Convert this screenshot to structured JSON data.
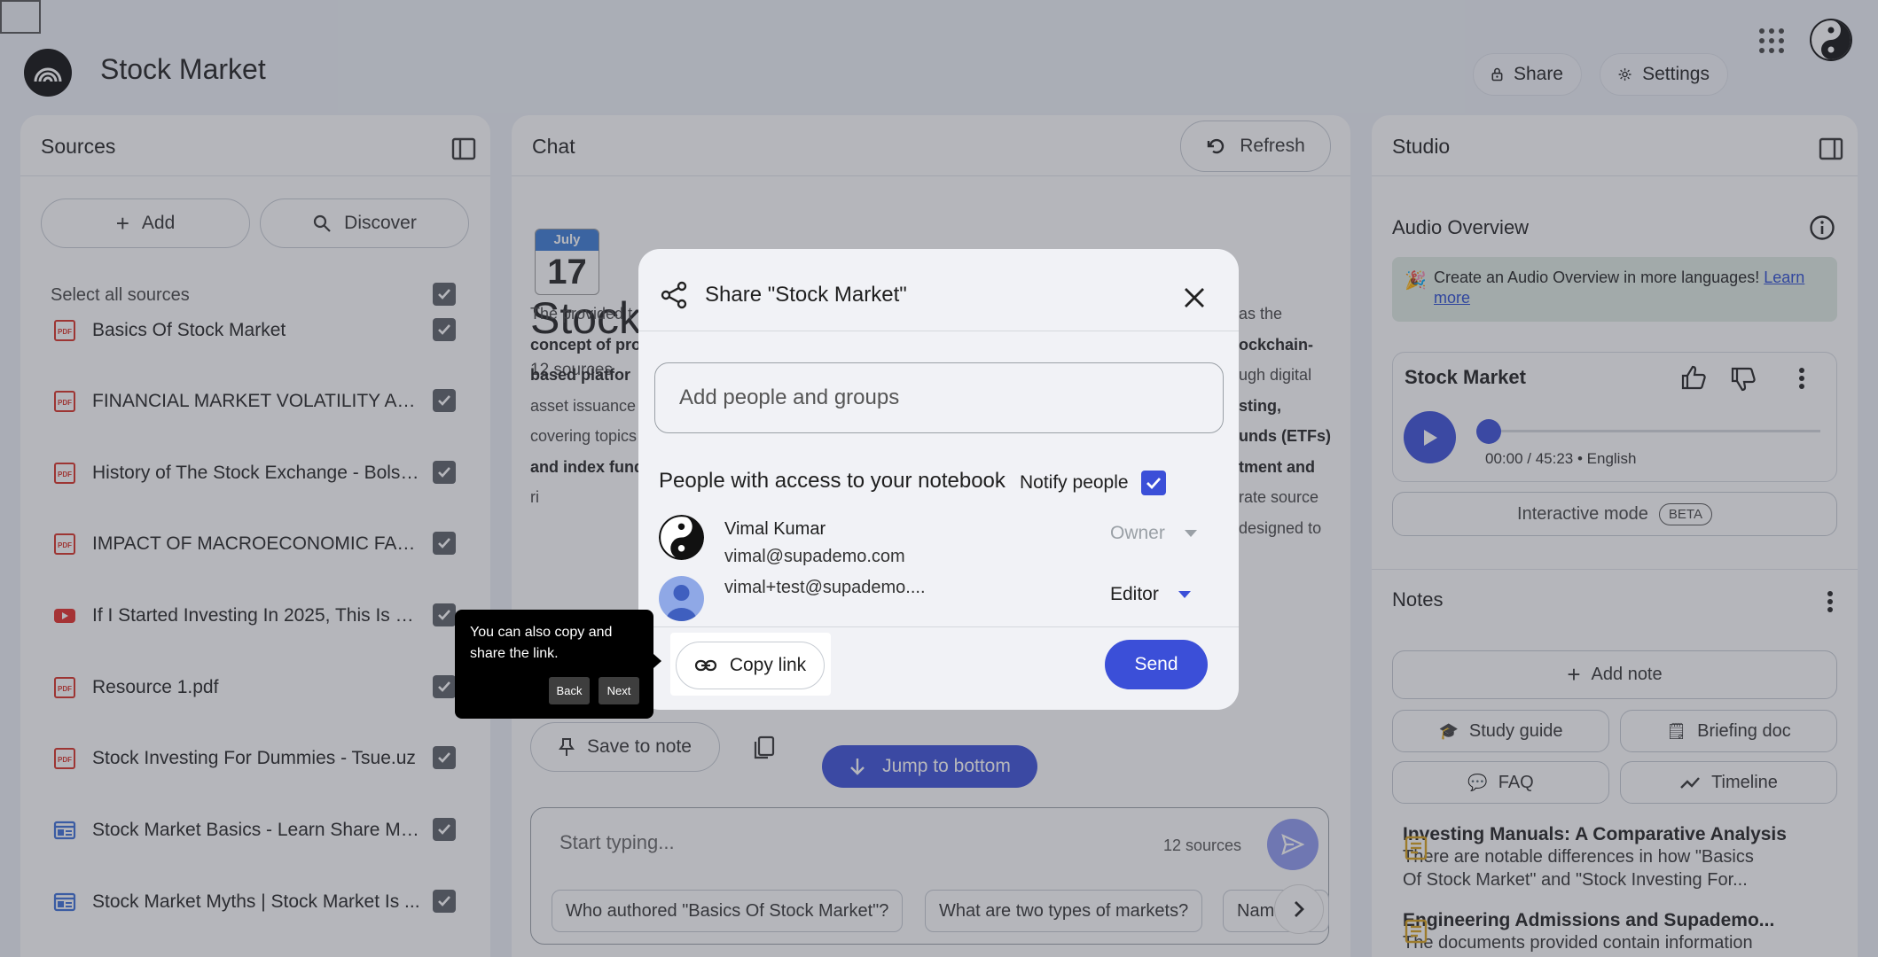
{
  "app": {
    "title": "Stock Market",
    "share_label": "Share",
    "settings_label": "Settings"
  },
  "sources": {
    "title": "Sources",
    "add_label": "Add",
    "discover_label": "Discover",
    "select_all_label": "Select all sources",
    "items": [
      {
        "label": "Basics Of Stock Market",
        "icon": "pdf-icon"
      },
      {
        "label": "FINANCIAL MARKET VOLATILITY AND I...",
        "icon": "pdf-icon"
      },
      {
        "label": "History of The Stock Exchange - Bolsa...",
        "icon": "pdf-icon"
      },
      {
        "label": "IMPACT OF MACROECONOMIC FACTO...",
        "icon": "pdf-icon"
      },
      {
        "label": "If I Started Investing In 2025, This Is W...",
        "icon": "youtube-icon"
      },
      {
        "label": "Resource 1.pdf",
        "icon": "pdf-icon"
      },
      {
        "label": "Stock Investing For Dummies - Tsue.uz",
        "icon": "pdf-icon"
      },
      {
        "label": "Stock Market Basics - Learn Share Ma...",
        "icon": "web-icon"
      },
      {
        "label": "Stock Market Myths | Stock Market Is ...",
        "icon": "web-icon"
      }
    ]
  },
  "chat": {
    "title": "Chat",
    "refresh_label": "Refresh",
    "calendar_month": "July",
    "calendar_day": "17",
    "notebook_title_partial": "Stock",
    "sources_count": "12 sources",
    "summary_lines": [
      {
        "left": "The provided t",
        "right": "as the"
      },
      {
        "left": "concept of pro",
        "right": "ockchain-"
      },
      {
        "left": "based platfor",
        "right": "ugh digital"
      },
      {
        "left": "asset issuance",
        "right": "sting,"
      },
      {
        "left": "covering topics",
        "right": "unds (ETFs)"
      },
      {
        "left": "and index fund",
        "right": "tment and"
      },
      {
        "left": "ri",
        "right": "rate source"
      },
      {
        "left": "",
        "right": "designed to"
      }
    ],
    "save_to_note_label": "Save to note",
    "jump_to_bottom_label": "Jump to bottom",
    "input_placeholder": "Start typing...",
    "input_sources_count": "12 sources",
    "suggestions": [
      "Who authored \"Basics Of Stock Market\"?",
      "What are two types of markets?",
      "Nam"
    ]
  },
  "studio": {
    "title": "Studio",
    "audio_overview_label": "Audio Overview",
    "banner_text": "Create an Audio Overview in more languages!",
    "banner_link": "Learn more",
    "audio_title": "Stock Market",
    "audio_time": "00:00 / 45:23 • English",
    "audio_progress": 0,
    "interactive_mode_label": "Interactive mode",
    "beta_label": "BETA",
    "notes_title": "Notes",
    "add_note_label": "Add note",
    "study_guide_label": "Study guide",
    "briefing_doc_label": "Briefing doc",
    "faq_label": "FAQ",
    "timeline_label": "Timeline",
    "notes": [
      {
        "title": "Investing Manuals: A Comparative Analysis",
        "body_lines": [
          "There are notable differences in how \"Basics",
          "Of Stock Market\" and \"Stock Investing For..."
        ]
      },
      {
        "title": "Engineering Admissions and Supademo...",
        "body_lines": [
          "The documents provided contain information"
        ]
      }
    ]
  },
  "share_dialog": {
    "title": "Share \"Stock Market\"",
    "input_placeholder": "Add people and groups",
    "access_title": "People with access to your notebook",
    "notify_label": "Notify people",
    "notify_checked": true,
    "people": [
      {
        "name": "Vimal Kumar",
        "email": "vimal@supademo.com",
        "role": "Owner"
      },
      {
        "name": "",
        "email": "vimal+test@supademo....",
        "role": "Editor"
      }
    ],
    "copy_link_label": "Copy link",
    "send_label": "Send"
  },
  "tooltip": {
    "text": "You can also copy and share the link.",
    "back_label": "Back",
    "next_label": "Next"
  },
  "colors": {
    "accent": "#3b4fd8",
    "background": "#eef1f7",
    "overlay": "rgba(60,64,75,0.38)"
  }
}
